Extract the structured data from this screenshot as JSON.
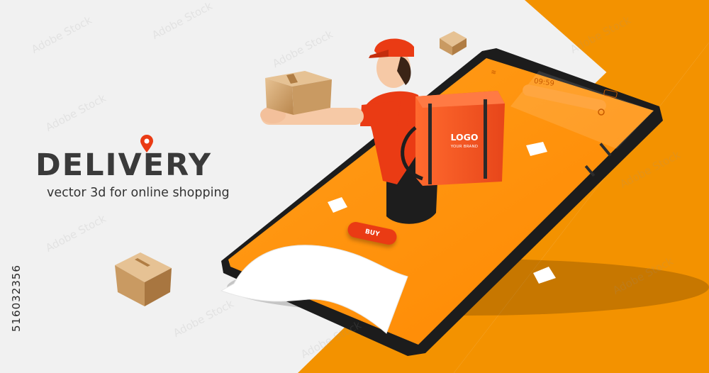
{
  "headline": {
    "title": "DELIVERY",
    "subtitle": "vector 3d for online shopping"
  },
  "phone_screen": {
    "clock": "09:59",
    "buy_button": "BUY"
  },
  "backpack": {
    "logo": "LOGO",
    "tagline": "YOUR BRAND"
  },
  "stock_id": "516032356",
  "watermark": "Adobe Stock",
  "colors": {
    "brand_orange": "#f39200",
    "deep_orange": "#ea3b14",
    "background": "#f1f1f1",
    "cardboard": "#c99a62"
  }
}
